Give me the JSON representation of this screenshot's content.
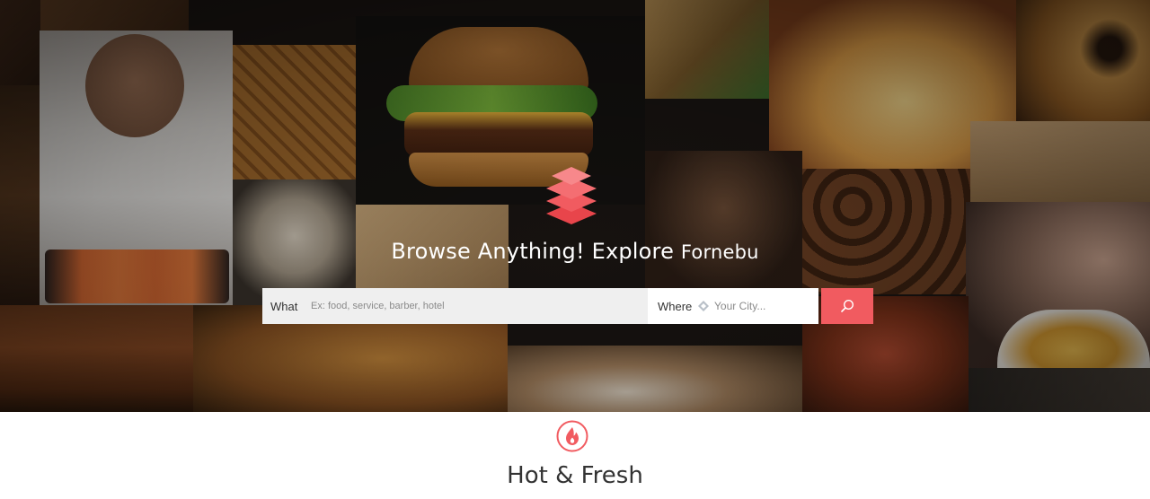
{
  "hero": {
    "headline_main": "Browse Anything! Explore",
    "headline_place": "Fornebu"
  },
  "search": {
    "what_label": "What",
    "what_placeholder": "Ex: food, service, barber, hotel",
    "where_label": "Where",
    "where_placeholder": "Your City..."
  },
  "icons": {
    "logo": "layers-icon",
    "location": "location-diamond-icon",
    "search": "search-icon",
    "section": "flame-icon"
  },
  "colors": {
    "accent": "#f15b60",
    "accent_dark": "#e8454b",
    "heading": "#333333",
    "field_bg": "#efefef"
  },
  "section": {
    "title": "Hot & Fresh"
  }
}
